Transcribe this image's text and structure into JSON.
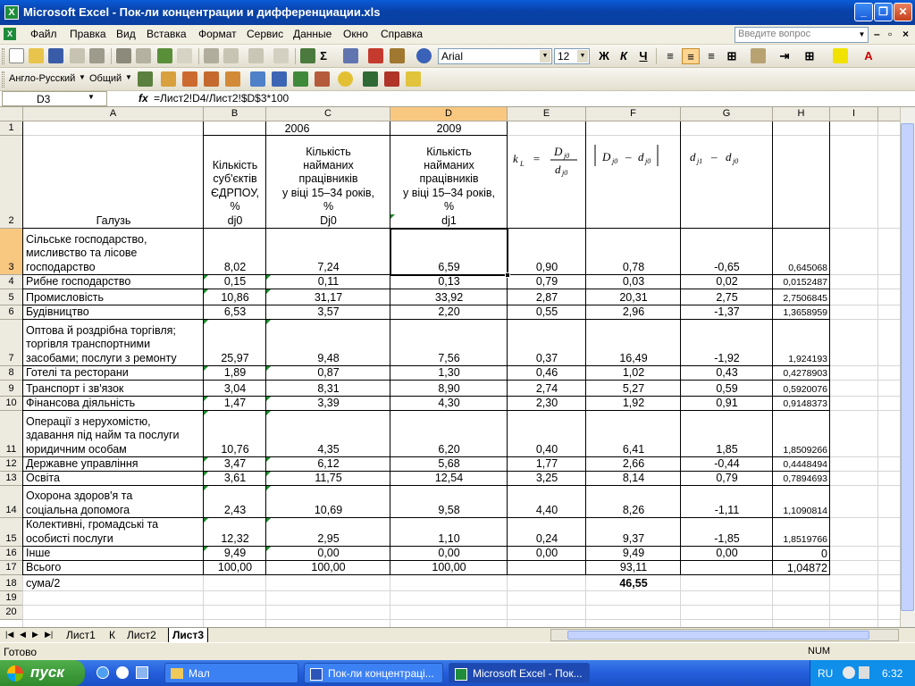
{
  "window": {
    "title": "Microsoft Excel - Пок-ли концентрации и дифференциации.xls"
  },
  "menu": {
    "items": [
      "Файл",
      "Правка",
      "Вид",
      "Вставка",
      "Формат",
      "Сервис",
      "Данные",
      "Окно",
      "Справка"
    ],
    "ask_placeholder": "Введите вопрос"
  },
  "toolbar": {
    "font": "Arial",
    "size": "12",
    "bold": "Ж",
    "italic": "К",
    "underline": "Ч"
  },
  "toolbar2": {
    "lang": "Англо-Русский",
    "common": "Общий"
  },
  "formula_bar": {
    "cell": "D3",
    "fx": "fx",
    "formula": "=Лист2!D4/Лист2!$D$3*100"
  },
  "columns": [
    "A",
    "B",
    "C",
    "D",
    "E",
    "F",
    "G",
    "H",
    "I"
  ],
  "rows": [
    "1",
    "2",
    "3",
    "4",
    "5",
    "6",
    "7",
    "8",
    "9",
    "10",
    "11",
    "12",
    "13",
    "14",
    "15",
    "16",
    "17",
    "18",
    "19",
    "20"
  ],
  "header": {
    "year_2006": "2006",
    "year_2009": "2009",
    "a2": "Галузь",
    "b2": [
      "Кількість",
      "суб'єктів",
      "ЄДРПОУ,",
      "%",
      "dj0"
    ],
    "c2": [
      "Кількість",
      "найманих",
      "працівників",
      "у віці 15–34 років,",
      "%",
      "Dj0"
    ],
    "d2": [
      "Кількість",
      "найманих",
      "працівників",
      "у віці 15–34 років,",
      "%",
      "dj1"
    ]
  },
  "table": [
    {
      "name": [
        "Сільське господарство,",
        "мисливство та лісове",
        "господарство"
      ],
      "b": "8,02",
      "c": "7,24",
      "d": "6,59",
      "e": "0,90",
      "f": "0,78",
      "g": "-0,65",
      "h": "0,645068"
    },
    {
      "name": [
        "Рибне господарство"
      ],
      "b": "0,15",
      "c": "0,11",
      "d": "0,13",
      "e": "0,79",
      "f": "0,03",
      "g": "0,02",
      "h": "0,0152487"
    },
    {
      "name": [
        "Промисловість"
      ],
      "b": "10,86",
      "c": "31,17",
      "d": "33,92",
      "e": "2,87",
      "f": "20,31",
      "g": "2,75",
      "h": "2,7506845"
    },
    {
      "name": [
        "Будівництво"
      ],
      "b": "6,53",
      "c": "3,57",
      "d": "2,20",
      "e": "0,55",
      "f": "2,96",
      "g": "-1,37",
      "h": "1,3658959"
    },
    {
      "name": [
        "Оптова й роздрібна торгівля;",
        "торгівля транспортними",
        "засобами; послуги з ремонту"
      ],
      "b": "25,97",
      "c": "9,48",
      "d": "7,56",
      "e": "0,37",
      "f": "16,49",
      "g": "-1,92",
      "h": "1,924193"
    },
    {
      "name": [
        "Готелі та ресторани"
      ],
      "b": "1,89",
      "c": "0,87",
      "d": "1,30",
      "e": "0,46",
      "f": "1,02",
      "g": "0,43",
      "h": "0,4278903"
    },
    {
      "name": [
        "Транспорт і зв'язок"
      ],
      "b": "3,04",
      "c": "8,31",
      "d": "8,90",
      "e": "2,74",
      "f": "5,27",
      "g": "0,59",
      "h": "0,5920076"
    },
    {
      "name": [
        "Фінансова діяльність"
      ],
      "b": "1,47",
      "c": "3,39",
      "d": "4,30",
      "e": "2,30",
      "f": "1,92",
      "g": "0,91",
      "h": "0,9148373"
    },
    {
      "name": [
        "Операції з нерухомістю,",
        "здавання під найм та послуги",
        "юридичним особам"
      ],
      "b": "10,76",
      "c": "4,35",
      "d": "6,20",
      "e": "0,40",
      "f": "6,41",
      "g": "1,85",
      "h": "1,8509266"
    },
    {
      "name": [
        "Державне управління"
      ],
      "b": "3,47",
      "c": "6,12",
      "d": "5,68",
      "e": "1,77",
      "f": "2,66",
      "g": "-0,44",
      "h": "0,4448494"
    },
    {
      "name": [
        "Освіта"
      ],
      "b": "3,61",
      "c": "11,75",
      "d": "12,54",
      "e": "3,25",
      "f": "8,14",
      "g": "0,79",
      "h": "0,7894693"
    },
    {
      "name": [
        "Охорона здоров'я та",
        "соціальна допомога"
      ],
      "b": "2,43",
      "c": "10,69",
      "d": "9,58",
      "e": "4,40",
      "f": "8,26",
      "g": "-1,11",
      "h": "1,1090814"
    },
    {
      "name": [
        "Колективні, громадські та",
        "особисті послуги"
      ],
      "b": "12,32",
      "c": "2,95",
      "d": "1,10",
      "e": "0,24",
      "f": "9,37",
      "g": "-1,85",
      "h": "1,8519766"
    },
    {
      "name": [
        "Інше"
      ],
      "b": "9,49",
      "c": "0,00",
      "d": "0,00",
      "e": "0,00",
      "f": "9,49",
      "g": "0,00",
      "h": "0"
    },
    {
      "name": [
        "Всього"
      ],
      "b": "100,00",
      "c": "100,00",
      "d": "100,00",
      "e": "",
      "f": "93,11",
      "g": "",
      "h": "1,04872"
    },
    {
      "name": [
        "сума/2"
      ],
      "b": "",
      "c": "",
      "d": "",
      "e": "",
      "f": "46,55",
      "g": "",
      "h": ""
    }
  ],
  "sheets": [
    "Лист1",
    "К",
    "Лист2",
    "Лист3"
  ],
  "status": {
    "ready": "Готово",
    "num": "NUM"
  },
  "taskbar": {
    "start": "пуск",
    "tasks": [
      "Мал",
      "Пок-ли концентраці...",
      "Microsoft Excel - Пок..."
    ],
    "lang": "RU",
    "time": "6:32"
  }
}
